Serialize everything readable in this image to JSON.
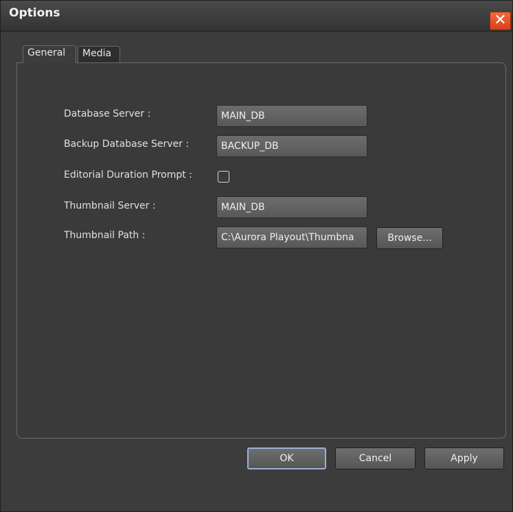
{
  "window": {
    "title": "Options",
    "close_symbol": "✕"
  },
  "tabs": [
    {
      "label": "General",
      "active": true
    },
    {
      "label": "Media",
      "active": false
    }
  ],
  "form": {
    "database_server": {
      "label": "Database Server :",
      "value": "MAIN_DB"
    },
    "backup_database_server": {
      "label": "Backup Database Server :",
      "value": "BACKUP_DB"
    },
    "editorial_duration_prompt": {
      "label": "Editorial Duration Prompt :",
      "checked": false
    },
    "thumbnail_server": {
      "label": "Thumbnail Server :",
      "value": "MAIN_DB"
    },
    "thumbnail_path": {
      "label": "Thumbnail Path :",
      "value": "C:\\Aurora Playout\\Thumbna",
      "browse_label": "Browse..."
    }
  },
  "buttons": {
    "ok": "OK",
    "cancel": "Cancel",
    "apply": "Apply"
  },
  "colors": {
    "close_button": "#e4542a",
    "default_button_outline": "#9bb3d6"
  },
  "icons": {
    "close": "close-icon"
  }
}
